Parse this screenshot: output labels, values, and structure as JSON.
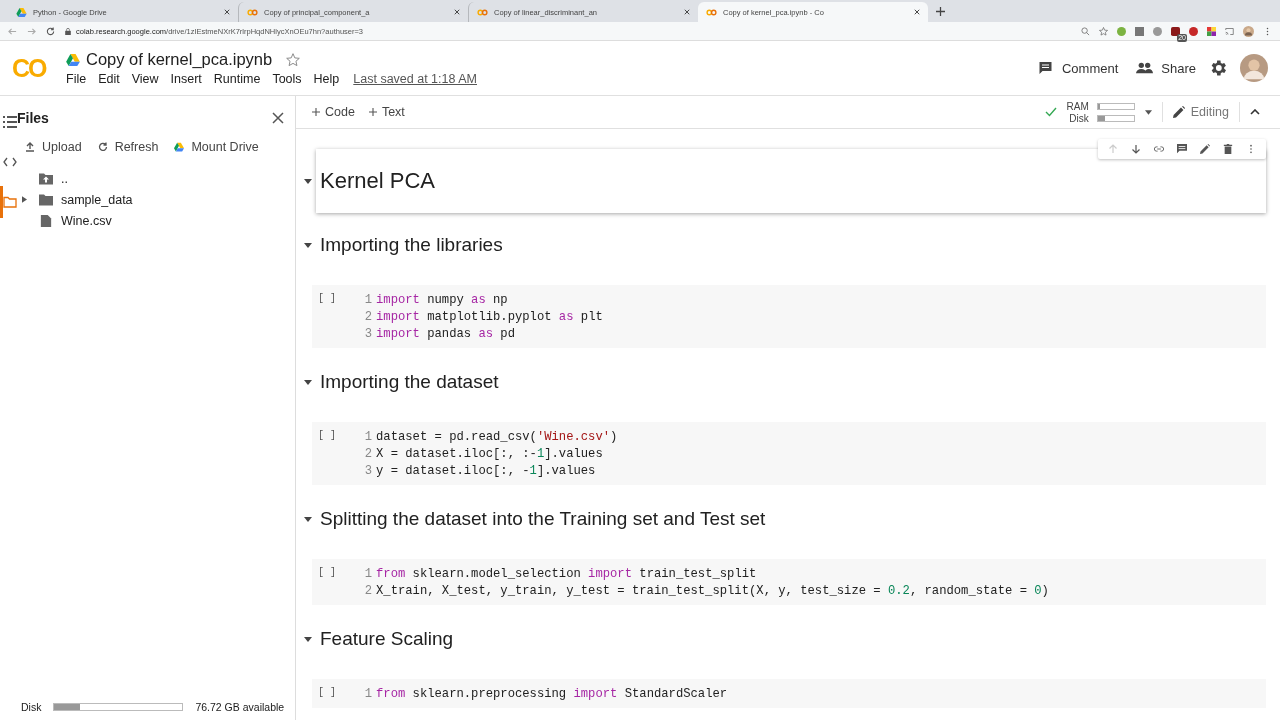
{
  "browser": {
    "tabs": [
      {
        "title": "Python - Google Drive",
        "selected": false
      },
      {
        "title": "Copy of principal_component_a",
        "selected": false
      },
      {
        "title": "Copy of linear_discriminant_an",
        "selected": false
      },
      {
        "title": "Copy of kernel_pca.ipynb - Co",
        "selected": true
      }
    ],
    "url_host": "colab.research.google.com",
    "url_path": "/drive/1zIEstmeNXrK7rlrpHqdNHlycXnOEu7hn?authuser=3",
    "extension_badge": "20"
  },
  "header": {
    "logo": "CO",
    "title": "Copy of kernel_pca.ipynb",
    "menu": [
      "File",
      "Edit",
      "View",
      "Insert",
      "Runtime",
      "Tools",
      "Help"
    ],
    "last_saved": "Last saved at 1:18 AM",
    "comment": "Comment",
    "share": "Share"
  },
  "sidebar": {
    "rail": [
      {
        "kind": "toc",
        "selected": false
      },
      {
        "kind": "code",
        "selected": false
      },
      {
        "kind": "files",
        "selected": true
      }
    ],
    "title": "Files",
    "actions": [
      {
        "kind": "upload",
        "label": "Upload"
      },
      {
        "kind": "refresh",
        "label": "Refresh"
      },
      {
        "kind": "drive",
        "label": "Mount Drive"
      }
    ],
    "items": [
      {
        "kind": "parent",
        "name": ".."
      },
      {
        "kind": "folder",
        "name": "sample_data",
        "expanded": false
      },
      {
        "kind": "file",
        "name": "Wine.csv"
      }
    ],
    "disk": {
      "label": "Disk",
      "level": 0.2,
      "reading": "76.72 GB available"
    }
  },
  "toolbar": {
    "add_code": "Code",
    "add_text": "Text",
    "ram": {
      "label": "RAM",
      "level": 0.05
    },
    "disk": {
      "label": "Disk",
      "level": 0.2
    },
    "mode": "Editing"
  },
  "cells": [
    {
      "heading": "Kernel PCA",
      "kind": "title",
      "selected": true
    },
    {
      "heading": "Importing the libraries",
      "kind": "section",
      "selected": false,
      "prompt": "[ ]",
      "lines": [
        {
          "n": "1",
          "tokens": [
            {
              "kind": "kw",
              "s": "import"
            },
            {
              "kind": "txt",
              "s": " numpy "
            },
            {
              "kind": "kw",
              "s": "as"
            },
            {
              "kind": "txt",
              "s": " np"
            }
          ]
        },
        {
          "n": "2",
          "tokens": [
            {
              "kind": "kw",
              "s": "import"
            },
            {
              "kind": "txt",
              "s": " matplotlib.pyplot "
            },
            {
              "kind": "kw",
              "s": "as"
            },
            {
              "kind": "txt",
              "s": " plt"
            }
          ]
        },
        {
          "n": "3",
          "tokens": [
            {
              "kind": "kw",
              "s": "import"
            },
            {
              "kind": "txt",
              "s": " pandas "
            },
            {
              "kind": "kw",
              "s": "as"
            },
            {
              "kind": "txt",
              "s": " pd"
            }
          ]
        }
      ]
    },
    {
      "heading": "Importing the dataset",
      "kind": "section",
      "selected": false,
      "prompt": "[ ]",
      "lines": [
        {
          "n": "1",
          "tokens": [
            {
              "kind": "txt",
              "s": "dataset = pd.read_csv("
            },
            {
              "kind": "str",
              "s": "'Wine.csv'"
            },
            {
              "kind": "txt",
              "s": ")"
            }
          ]
        },
        {
          "n": "2",
          "tokens": [
            {
              "kind": "txt",
              "s": "X = dataset.iloc[:, :-"
            },
            {
              "kind": "num",
              "s": "1"
            },
            {
              "kind": "txt",
              "s": "].values"
            }
          ]
        },
        {
          "n": "3",
          "tokens": [
            {
              "kind": "txt",
              "s": "y = dataset.iloc[:, -"
            },
            {
              "kind": "num",
              "s": "1"
            },
            {
              "kind": "txt",
              "s": "].values"
            }
          ]
        }
      ]
    },
    {
      "heading": "Splitting the dataset into the Training set and Test set",
      "kind": "section",
      "selected": false,
      "prompt": "[ ]",
      "lines": [
        {
          "n": "1",
          "tokens": [
            {
              "kind": "kw",
              "s": "from"
            },
            {
              "kind": "txt",
              "s": " sklearn.model_selection "
            },
            {
              "kind": "kw",
              "s": "import"
            },
            {
              "kind": "txt",
              "s": " train_test_split"
            }
          ]
        },
        {
          "n": "2",
          "tokens": [
            {
              "kind": "txt",
              "s": "X_train, X_test, y_train, y_test = train_test_split(X, y, test_size = "
            },
            {
              "kind": "num",
              "s": "0.2"
            },
            {
              "kind": "txt",
              "s": ", random_state = "
            },
            {
              "kind": "num",
              "s": "0"
            },
            {
              "kind": "txt",
              "s": ")"
            }
          ]
        }
      ]
    },
    {
      "heading": "Feature Scaling",
      "kind": "section",
      "selected": false,
      "prompt": "[ ]",
      "lines": [
        {
          "n": "1",
          "tokens": [
            {
              "kind": "kw",
              "s": "from"
            },
            {
              "kind": "txt",
              "s": " sklearn.preprocessing "
            },
            {
              "kind": "kw",
              "s": "import"
            },
            {
              "kind": "txt",
              "s": " StandardScaler"
            }
          ]
        }
      ]
    }
  ]
}
